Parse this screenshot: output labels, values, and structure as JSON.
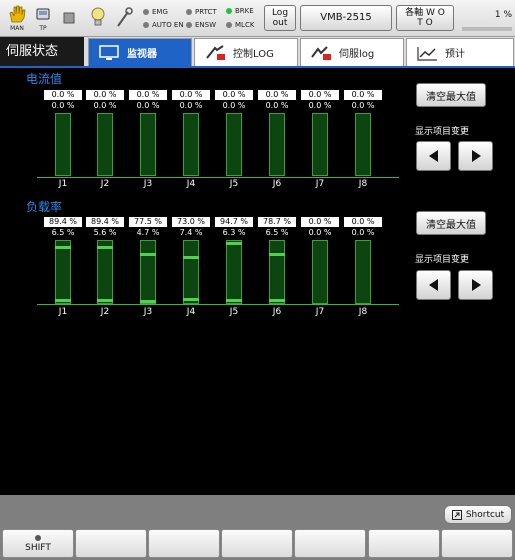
{
  "topbar": {
    "icons": [
      {
        "name": "man-hand-icon",
        "caption": "MAN"
      },
      {
        "name": "teach-pendant-icon",
        "caption": "TP"
      },
      {
        "name": "stop-square-icon",
        "caption": ""
      },
      {
        "name": "lightbulb-icon",
        "caption": ""
      },
      {
        "name": "wrench-icon",
        "caption": ""
      }
    ],
    "indicators": [
      {
        "label": "EMG",
        "on": false
      },
      {
        "label": "AUTO EN",
        "on": false
      },
      {
        "label": "PRTCT",
        "on": false
      },
      {
        "label": "ENSW",
        "on": false
      },
      {
        "label": "BRKE",
        "on": true
      },
      {
        "label": "MLCK",
        "on": false
      }
    ],
    "logout_label": "Log out",
    "robot_label": "VMB-2515",
    "axis_label": "各軸 W O T O",
    "percent": "1 %",
    "indicator_on_color": "#24c23b"
  },
  "title": "伺服状态",
  "tabs": [
    {
      "label": "监视器",
      "icon": "monitor-icon",
      "active": true
    },
    {
      "label": "控制LOG",
      "icon": "control-log-icon",
      "active": false
    },
    {
      "label": "伺服log",
      "icon": "servo-log-icon",
      "active": false
    },
    {
      "label": "预计",
      "icon": "forecast-chart-icon",
      "active": false
    }
  ],
  "joints": [
    "J1",
    "J2",
    "J3",
    "J4",
    "J5",
    "J6",
    "J7",
    "J8"
  ],
  "current": {
    "title": "电流值",
    "max_values": [
      "0.0 %",
      "0.0 %",
      "0.0 %",
      "0.0 %",
      "0.0 %",
      "0.0 %",
      "0.0 %",
      "0.0 %"
    ],
    "cur_values": [
      "0.0 %",
      "0.0 %",
      "0.0 %",
      "0.0 %",
      "0.0 %",
      "0.0 %",
      "0.0 %",
      "0.0 %"
    ],
    "clear_label": "清空最大值",
    "switch_label": "显示项目变更"
  },
  "load": {
    "title": "负载率",
    "max_values": [
      "89.4 %",
      "89.4 %",
      "77.5 %",
      "73.0 %",
      "94.7 %",
      "78.7 %",
      "0.0 %",
      "0.0 %"
    ],
    "cur_values": [
      "6.5 %",
      "5.6 %",
      "4.7 %",
      "7.4 %",
      "6.3 %",
      "6.5 %",
      "0.0 %",
      "0.0 %"
    ],
    "max_fraction": [
      0.894,
      0.894,
      0.775,
      0.73,
      0.947,
      0.787,
      0.0,
      0.0
    ],
    "cur_fraction": [
      0.065,
      0.056,
      0.047,
      0.074,
      0.063,
      0.065,
      0.0,
      0.0
    ],
    "clear_label": "清空最大值",
    "switch_label": "显示项目变更"
  },
  "shortcut_label": "Shortcut",
  "fkeys": [
    "SHIFT",
    "",
    "",
    "",
    "",
    "",
    ""
  ],
  "colors": {
    "accent": "#1e63c5",
    "section_title": "#2f86e6",
    "bar_marker": "#4fd24f"
  }
}
